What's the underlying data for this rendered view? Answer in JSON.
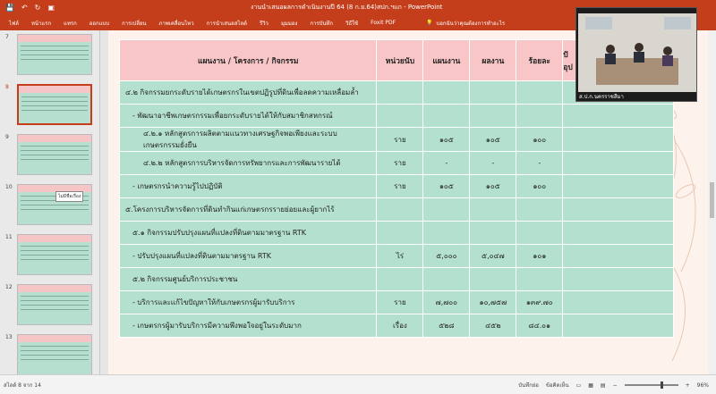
{
  "titlebar": {
    "title": "งานนำเสนอผลการดำเนินงานปี 64 (8 ก.ย.64)สปก.ฯแก - PowerPoint",
    "save_icon": "save-icon",
    "undo_icon": "undo-icon",
    "redo_icon": "redo-icon",
    "present_icon": "present-icon"
  },
  "ribbon": {
    "tabs": [
      "ไฟล์",
      "หน้าแรก",
      "แทรก",
      "ออกแบบ",
      "การเปลี่ยน",
      "ภาพเคลื่อนไหว",
      "การนำเสนอสไลด์",
      "รีวิว",
      "มุมมอง",
      "การบันทึก",
      "วิธีใช้",
      "Foxit PDF"
    ],
    "tell_me": "บอกฉันว่าคุณต้องการทำอะไร"
  },
  "thumbnails": {
    "numbers": [
      "7",
      "8",
      "9",
      "10",
      "11",
      "12",
      "13"
    ],
    "active_index": 1,
    "tooltip": "ไม่มีชื่อเรื่อง"
  },
  "table": {
    "headers": [
      "แผนงาน / โครงการ / กิจกรรม",
      "หน่วยนับ",
      "แผนงาน",
      "ผลงาน",
      "ร้อยละ",
      "ปั\nอุป"
    ],
    "rows": [
      {
        "text": "๔.๒ กิจกรรมยกระดับรายได้เกษตรกรในเขตปฏิรูปที่ดินเพื่อลดความเหลื่อมล้ำ",
        "unit": "",
        "plan": "",
        "result": "",
        "percent": "",
        "indent": 0
      },
      {
        "text": "- พัฒนาอาชีพเกษตรกรรมเพื่อยกระดับรายได้ให้กับสมาชิกสหกรณ์",
        "unit": "",
        "plan": "",
        "result": "",
        "percent": "",
        "indent": 1
      },
      {
        "text": "๔.๒.๑ หลักสูตรการผลิตตามแนวทางเศรษฐกิจพอเพียงและระบบเกษตรกรรมยั่งยืน",
        "unit": "ราย",
        "plan": "๑๐๕",
        "result": "๑๐๕",
        "percent": "๑๐๐",
        "indent": 2
      },
      {
        "text": "๔.๒.๒ หลักสูตรการบริหารจัดการทรัพยากรและการพัฒนารายได้",
        "unit": "ราย",
        "plan": "-",
        "result": "-",
        "percent": "-",
        "indent": 2
      },
      {
        "text": "- เกษตรกรนำความรู้ไปปฏิบัติ",
        "unit": "ราย",
        "plan": "๑๐๕",
        "result": "๑๐๕",
        "percent": "๑๐๐",
        "indent": 1
      },
      {
        "text": "๕.โครงการบริหารจัดการที่ดินทำกินแก่เกษตรกรรายย่อยและผู้ยากไร้",
        "unit": "",
        "plan": "",
        "result": "",
        "percent": "",
        "indent": 0
      },
      {
        "text": "๕.๑ กิจกรรมปรับปรุงแผนที่แปลงที่ดินตามมาตรฐาน RTK",
        "unit": "",
        "plan": "",
        "result": "",
        "percent": "",
        "indent": 1
      },
      {
        "text": "- ปรับปรุงแผนที่แปลงที่ดินตามมาตรฐาน RTK",
        "unit": "ไร่",
        "plan": "๕,๐๐๐",
        "result": "๕,๐๔๗",
        "percent": "๑๐๑",
        "indent": 1
      },
      {
        "text": "๕.๒ กิจกรรมศูนย์บริการประชาชน",
        "unit": "",
        "plan": "",
        "result": "",
        "percent": "",
        "indent": 1
      },
      {
        "text": "- บริการและแก้ไขปัญหาให้กับเกษตรกรผู้มารับบริการ",
        "unit": "ราย",
        "plan": "๗,๗๐๐",
        "result": "๑๐,๗๕๗",
        "percent": "๑๓๙.๗๐",
        "indent": 1
      },
      {
        "text": "- เกษตรกรผู้มารับบริการมีความพึงพอใจอยู่ในระดับมาก",
        "unit": "เรื่อง",
        "plan": "๕๒๘",
        "result": "๔๕๒",
        "percent": "๘๔.๐๑",
        "indent": 1
      }
    ]
  },
  "video": {
    "label": "ส.ป.ก.นครราชสีมา"
  },
  "status": {
    "slide_info": "สไลด์ 8 จาก 14",
    "notes": "บันทึกย่อ",
    "comments": "ข้อคิดเห็น",
    "zoom": "96%"
  },
  "colors": {
    "accent": "#c43e1c",
    "header": "#f8c6c6",
    "cell": "#b4e0cf",
    "slide_bg": "#fdf3ec"
  }
}
